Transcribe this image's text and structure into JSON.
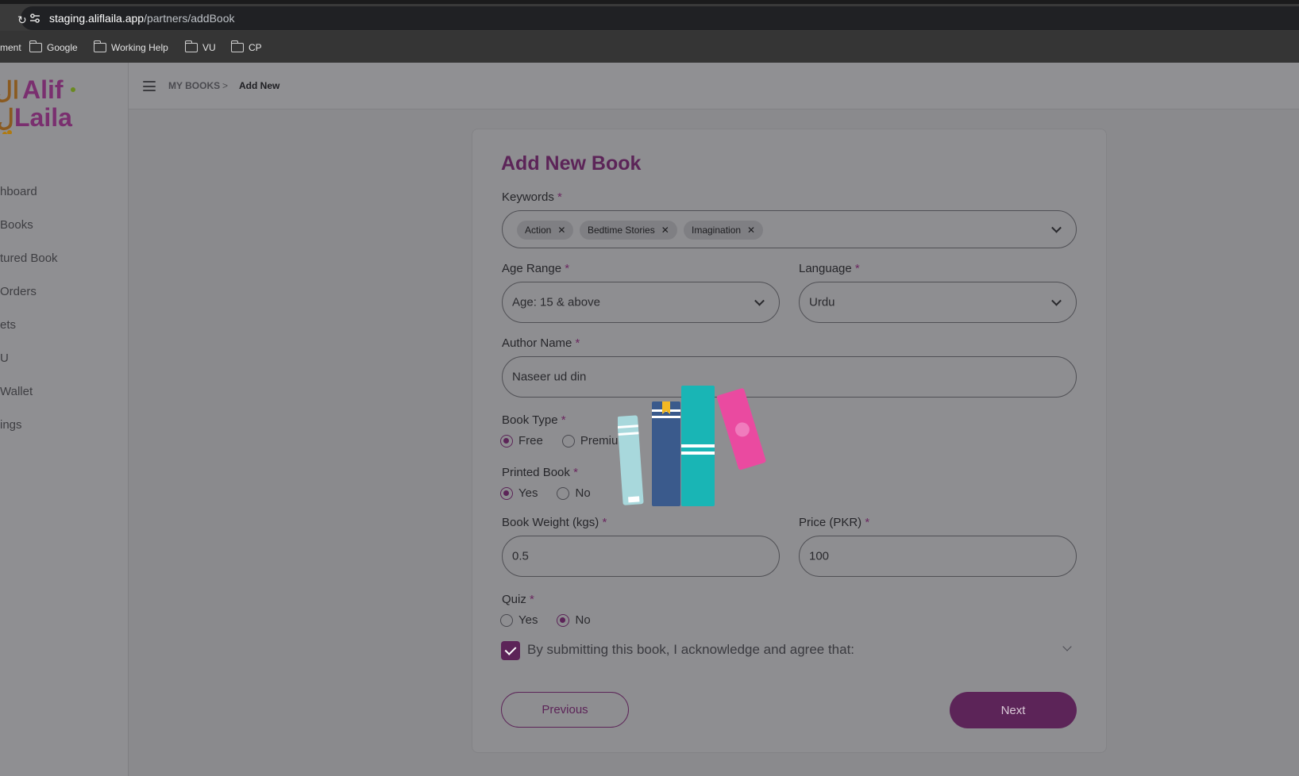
{
  "browser": {
    "url_host": "staging.aliflaila.app",
    "url_path": "/partners/addBook",
    "bookmarks": [
      "ment",
      "Google",
      "Working Help",
      "VU",
      "CP"
    ]
  },
  "sidebar": {
    "logo_text_top": "Alif",
    "logo_text_bottom": "Laila",
    "items": [
      {
        "label": "hboard"
      },
      {
        "label": "Books"
      },
      {
        "label": "tured Book"
      },
      {
        "label": "Orders"
      },
      {
        "label": "ets"
      },
      {
        "label": "U"
      },
      {
        "label": "Wallet"
      },
      {
        "label": "ings"
      }
    ]
  },
  "breadcrumb": {
    "parent": "MY BOOKS",
    "separator": ">",
    "current": "Add New"
  },
  "form": {
    "title": "Add New Book",
    "required_mark": "*",
    "keywords": {
      "label": "Keywords",
      "chips": [
        "Action",
        "Bedtime Stories",
        "Imagination"
      ],
      "chip_remove": "✕"
    },
    "age_range": {
      "label": "Age Range",
      "value": "Age: 15 & above"
    },
    "language": {
      "label": "Language",
      "value": "Urdu"
    },
    "author": {
      "label": "Author Name",
      "value": "Naseer ud din"
    },
    "book_type": {
      "label": "Book Type",
      "options": [
        "Free",
        "Premiur"
      ],
      "selected": "Free"
    },
    "printed_book": {
      "label": "Printed Book",
      "options": [
        "Yes",
        "No"
      ],
      "selected": "Yes"
    },
    "weight": {
      "label": "Book Weight (kgs)",
      "value": "0.5"
    },
    "price": {
      "label": "Price (PKR)",
      "value": "100"
    },
    "quiz": {
      "label": "Quiz",
      "options": [
        "Yes",
        "No"
      ],
      "selected": "No"
    },
    "agreement": {
      "text": "By submitting this book, I acknowledge and agree that:",
      "checked": true
    },
    "previous_label": "Previous",
    "next_label": "Next"
  },
  "colors": {
    "accent": "#5c2458",
    "overlay": "#8e8e91"
  }
}
